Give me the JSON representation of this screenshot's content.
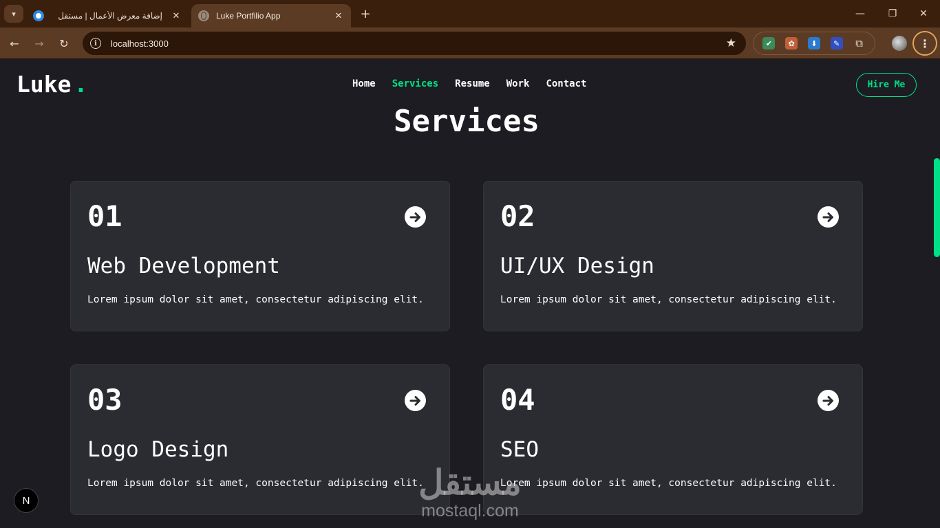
{
  "browser": {
    "tabs": [
      {
        "title": "إضافة معرض الأعمال | مستقل",
        "icon": "mostaql-icon",
        "active": false
      },
      {
        "title": "Luke Portfilio App",
        "icon": "globe-icon",
        "active": true
      }
    ],
    "new_tab_label": "+",
    "url": "localhost:3000",
    "window_controls": {
      "minimize": "—",
      "restore": "❐",
      "close": "✕"
    },
    "nav": {
      "back": "←",
      "forward": "→",
      "reload": "↻"
    },
    "star": "★",
    "menu": "⋮"
  },
  "site": {
    "logo": "Luke",
    "logo_dot": ".",
    "nav": [
      {
        "label": "Home",
        "active": false
      },
      {
        "label": "Services",
        "active": true
      },
      {
        "label": "Resume",
        "active": false
      },
      {
        "label": "Work",
        "active": false
      },
      {
        "label": "Contact",
        "active": false
      }
    ],
    "hire_button": "Hire Me",
    "accent_color": "#00e187"
  },
  "services": {
    "title": "Services",
    "items": [
      {
        "num": "01",
        "title": "Web Development",
        "description": "Lorem ipsum dolor sit amet, consectetur adipiscing elit."
      },
      {
        "num": "02",
        "title": "UI/UX Design",
        "description": "Lorem ipsum dolor sit amet, consectetur adipiscing elit."
      },
      {
        "num": "03",
        "title": "Logo Design",
        "description": "Lorem ipsum dolor sit amet, consectetur adipiscing elit."
      },
      {
        "num": "04",
        "title": "SEO",
        "description": "Lorem ipsum dolor sit amet, consectetur adipiscing elit."
      }
    ]
  },
  "next_badge": "N",
  "watermark": {
    "arabic": "مستقل",
    "latin": "mostaql.com"
  }
}
